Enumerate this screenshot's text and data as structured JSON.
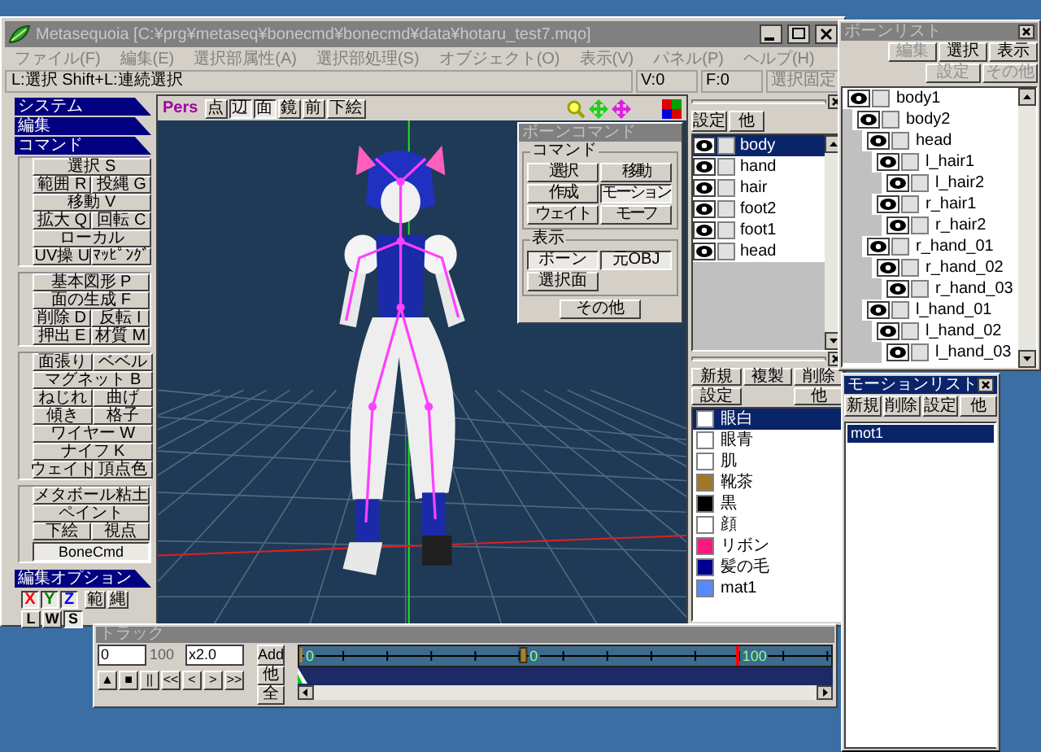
{
  "window": {
    "title": "Metasequoia [C:¥prg¥metaseq¥bonecmd¥bonecmd¥data¥hotaru_test7.mqo]"
  },
  "menu": [
    "ファイル(F)",
    "編集(E)",
    "選択部属性(A)",
    "選択部処理(S)",
    "オブジェクト(O)",
    "表示(V)",
    "パネル(P)",
    "ヘルプ(H)"
  ],
  "status_bar": {
    "hint": "L:選択  Shift+L:連続選択",
    "vertices": "V:0",
    "faces": "F:0",
    "lock_button": "選択固定"
  },
  "left_panel": {
    "headers": [
      "システム",
      "編集",
      "コマンド"
    ],
    "groups": [
      [
        [
          "選択 S"
        ],
        [
          "範囲 R",
          "投縄 G"
        ],
        [
          "移動 V"
        ],
        [
          "拡大 Q",
          "回転 C"
        ],
        [
          "ローカル"
        ],
        [
          "UV操 U",
          "ﾏｯﾋﾟﾝｸﾞ"
        ]
      ],
      [
        [
          "基本図形 P"
        ],
        [
          "面の生成 F"
        ],
        [
          "削除 D",
          "反転 I"
        ],
        [
          "押出 E",
          "材質 M"
        ]
      ],
      [
        [
          "面張り",
          "ベベル"
        ],
        [
          "マグネット B"
        ],
        [
          "ねじれ",
          "曲げ"
        ],
        [
          "傾き",
          "格子"
        ],
        [
          "ワイヤー W"
        ],
        [
          "ナイフ K"
        ],
        [
          "ウェイト",
          "頂点色"
        ]
      ],
      [
        [
          "メタボール粘土"
        ],
        [
          "ペイント"
        ],
        [
          "下絵",
          "視点"
        ]
      ]
    ],
    "plugin_button": {
      "label": "BoneCmd",
      "selected": true
    },
    "options_header": "編集オプション",
    "options": [
      {
        "label": "X",
        "on": true,
        "color": "#ff0000"
      },
      {
        "label": "Y",
        "on": true,
        "color": "#008000"
      },
      {
        "label": "Z",
        "on": true,
        "color": "#0000ff"
      },
      {
        "label": "範",
        "on": false,
        "color": "#000000"
      },
      {
        "label": "縄",
        "on": false,
        "color": "#000000"
      }
    ],
    "options_row2": [
      {
        "label": "L",
        "on": false
      },
      {
        "label": "W",
        "on": false
      },
      {
        "label": "S",
        "on": true
      }
    ]
  },
  "viewport": {
    "mode": "Pers",
    "buttons": [
      {
        "label": "点",
        "on": false
      },
      {
        "label": "辺",
        "on": true
      },
      {
        "label": "面",
        "on": true
      },
      {
        "label": "鏡",
        "on": false
      },
      {
        "label": "前",
        "on": false
      },
      {
        "label": "下絵",
        "on": false
      }
    ]
  },
  "bone_command": {
    "title": "ボーンコマンド",
    "command_group": "コマンド",
    "commands": [
      {
        "label": "選択",
        "selected": false
      },
      {
        "label": "移動",
        "selected": false
      },
      {
        "label": "作成",
        "selected": false
      },
      {
        "label": "モーション",
        "selected": true
      },
      {
        "label": "ウェイト",
        "selected": false
      },
      {
        "label": "モーフ",
        "selected": false
      }
    ],
    "display_group": "表示",
    "display": [
      {
        "label": "ボーン",
        "on": true
      },
      {
        "label": "元OBJ",
        "on": true
      },
      {
        "label": "選択面",
        "on": false
      }
    ],
    "other_button": "その他"
  },
  "object_panel": {
    "buttons": [
      "設定",
      "他"
    ],
    "objects": [
      {
        "name": "body",
        "selected": true
      },
      {
        "name": "hand",
        "selected": false
      },
      {
        "name": "hair",
        "selected": false
      },
      {
        "name": "foot2",
        "selected": false
      },
      {
        "name": "foot1",
        "selected": false
      },
      {
        "name": "head",
        "selected": false
      }
    ]
  },
  "material_panel": {
    "buttons": [
      "新規",
      "複製",
      "削除",
      "設定",
      "他"
    ],
    "materials": [
      {
        "name": "眼白",
        "color": "#ffffff",
        "selected": true
      },
      {
        "name": "眼青",
        "color": "#ffffff",
        "selected": false
      },
      {
        "name": "肌",
        "color": "#ffffff",
        "selected": false
      },
      {
        "name": "靴茶",
        "color": "#a07828",
        "selected": false
      },
      {
        "name": "黒",
        "color": "#000000",
        "selected": false
      },
      {
        "name": "顔",
        "color": "#ffffff",
        "selected": false
      },
      {
        "name": "リボン",
        "color": "#ff1880",
        "selected": false
      },
      {
        "name": "髪の毛",
        "color": "#000090",
        "selected": false
      },
      {
        "name": "mat1",
        "color": "#5888ff",
        "selected": false
      }
    ]
  },
  "bone_list": {
    "title": "ボーンリスト",
    "buttons": [
      {
        "label": "編集",
        "disabled": true
      },
      {
        "label": "選択",
        "disabled": false
      },
      {
        "label": "表示",
        "disabled": false
      },
      {
        "label": "設定",
        "disabled": true
      },
      {
        "label": "その他",
        "disabled": true
      }
    ],
    "bones": [
      {
        "name": "body1",
        "children": [
          {
            "name": "body2",
            "children": [
              {
                "name": "head",
                "children": [
                  {
                    "name": "l_hair1",
                    "children": [
                      {
                        "name": "l_hair2"
                      }
                    ]
                  },
                  {
                    "name": "r_hair1",
                    "children": [
                      {
                        "name": "r_hair2"
                      }
                    ]
                  }
                ]
              },
              {
                "name": "r_hand_01",
                "children": [
                  {
                    "name": "r_hand_02",
                    "children": [
                      {
                        "name": "r_hand_03"
                      }
                    ]
                  }
                ]
              },
              {
                "name": "l_hand_01",
                "children": [
                  {
                    "name": "l_hand_02",
                    "children": [
                      {
                        "name": "l_hand_03"
                      }
                    ]
                  }
                ]
              }
            ]
          }
        ]
      }
    ]
  },
  "motion_list": {
    "title": "モーションリスト",
    "buttons": [
      "新規",
      "削除",
      "設定",
      "他"
    ],
    "motions": [
      {
        "name": "mot1",
        "selected": true
      }
    ]
  },
  "track": {
    "title": "トラック",
    "frame": "0",
    "length": "100",
    "speed": "x2.0",
    "buttons": [
      "Add",
      "他",
      "全"
    ],
    "transport": [
      "▲",
      "■",
      "||",
      "<<",
      "<",
      ">",
      ">>"
    ],
    "ruler_labels": [
      "0",
      "0",
      "100"
    ]
  }
}
